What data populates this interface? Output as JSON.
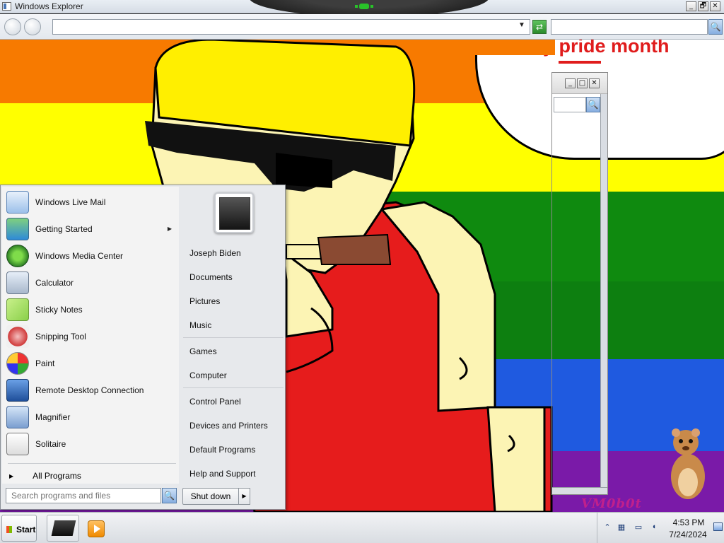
{
  "explorer": {
    "title": "Windows Explorer",
    "window_buttons": [
      "_",
      "🗗",
      "✕"
    ],
    "address_value": "",
    "search_value": ""
  },
  "wallpaper": {
    "speech_bubble_text": "y pride month",
    "watermark_text": "VM0b0t",
    "stripe_colors": [
      "#f77a00",
      "#ffff00",
      "#0f8a0f",
      "#1f5ae0",
      "#7a1aa8"
    ]
  },
  "start_menu": {
    "programs": [
      {
        "label": "Windows Live Mail",
        "icon": "mail-icon",
        "has_submenu": false
      },
      {
        "label": "Getting Started",
        "icon": "getting-started-icon",
        "has_submenu": true
      },
      {
        "label": "Windows Media Center",
        "icon": "media-center-icon",
        "has_submenu": false
      },
      {
        "label": "Calculator",
        "icon": "calculator-icon",
        "has_submenu": false
      },
      {
        "label": "Sticky Notes",
        "icon": "sticky-notes-icon",
        "has_submenu": false
      },
      {
        "label": "Snipping Tool",
        "icon": "scissors-icon",
        "has_submenu": false
      },
      {
        "label": "Paint",
        "icon": "paint-palette-icon",
        "has_submenu": false
      },
      {
        "label": "Remote Desktop Connection",
        "icon": "remote-desktop-icon",
        "has_submenu": false
      },
      {
        "label": "Magnifier",
        "icon": "magnifier-icon",
        "has_submenu": false
      },
      {
        "label": "Solitaire",
        "icon": "cards-icon",
        "has_submenu": false
      }
    ],
    "all_programs": "All Programs",
    "search_placeholder": "Search programs and files",
    "places_group1": [
      "Joseph Biden",
      "Documents",
      "Pictures",
      "Music"
    ],
    "places_group2": [
      "Games",
      "Computer"
    ],
    "places_group3": [
      "Control Panel",
      "Devices and Printers",
      "Default Programs",
      "Help and Support"
    ],
    "shutdown_label": "Shut down"
  },
  "taskbar": {
    "start_label": "Start",
    "clock_time": "4:53 PM",
    "clock_date": "7/24/2024",
    "tray_icons": [
      "show-hidden-icons-icon",
      "network-icon",
      "display-icon",
      "volume-icon"
    ]
  }
}
